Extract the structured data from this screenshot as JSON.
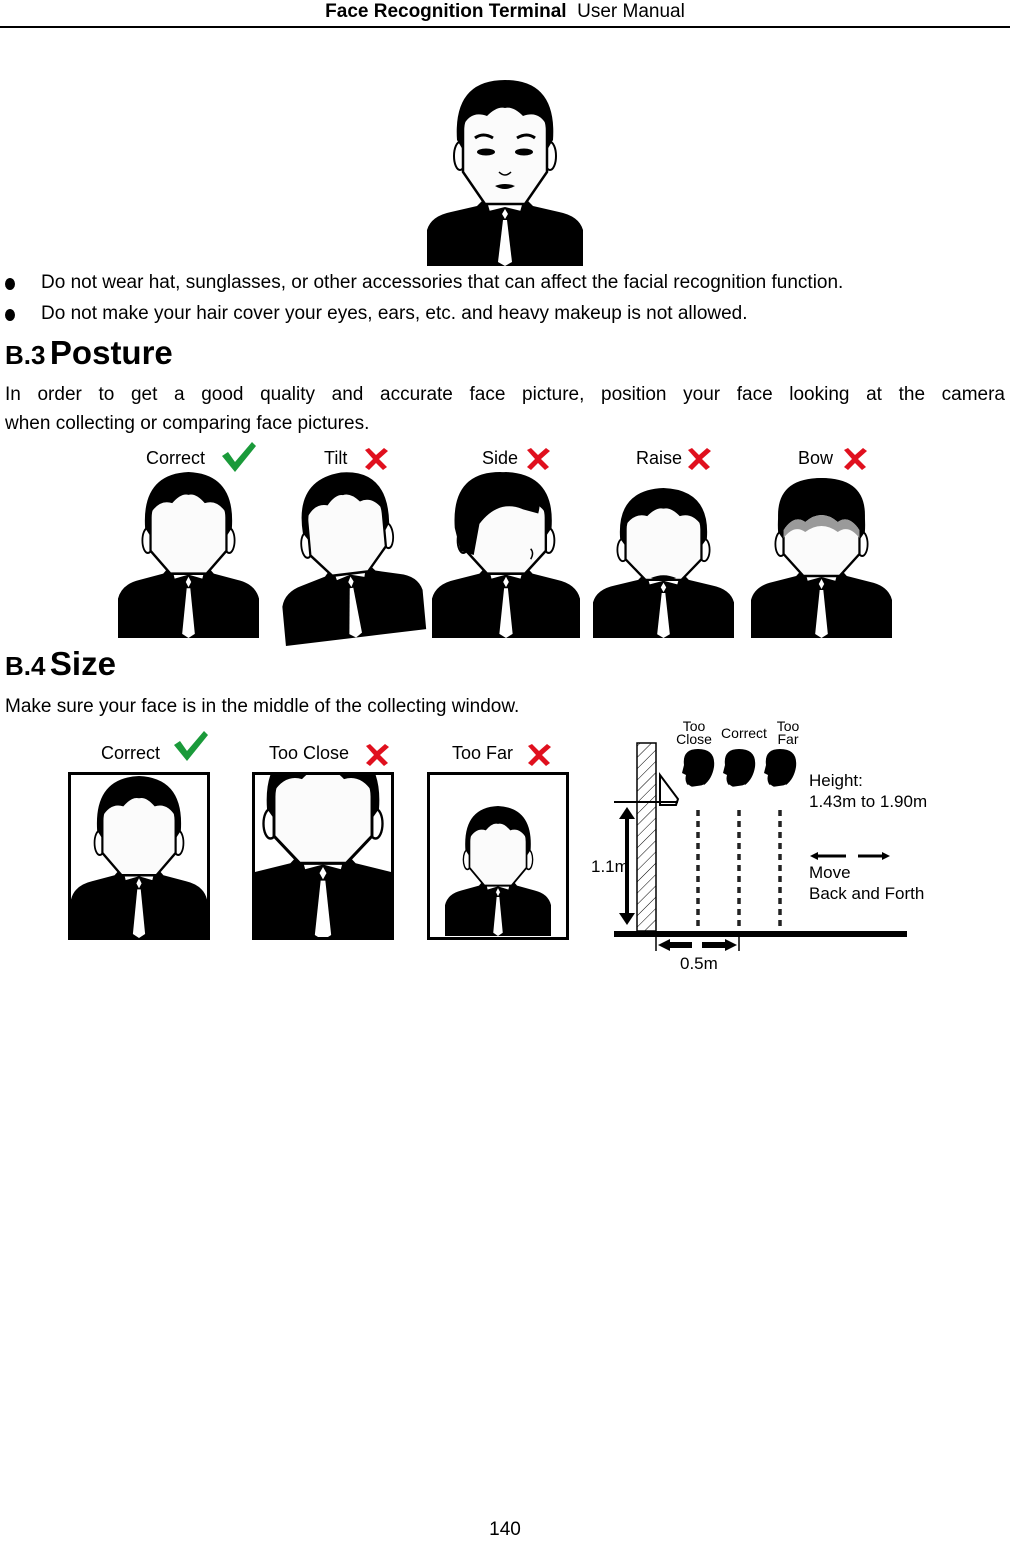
{
  "header": {
    "product": "Face Recognition Terminal",
    "doc": "User Manual"
  },
  "bullets": [
    "Do not wear hat, sunglasses, or other accessories that can affect the facial recognition function.",
    "Do not make your hair cover your eyes, ears, etc. and heavy makeup is not allowed."
  ],
  "posture": {
    "number": "B.3",
    "title": "Posture",
    "body_line1": "In order to get a good quality and accurate face picture, position your face looking at the camera",
    "body_line2": "when collecting or comparing face pictures.",
    "figures": [
      {
        "label": "Correct",
        "status": "check-icon"
      },
      {
        "label": "Tilt",
        "status": "cross-icon"
      },
      {
        "label": "Side",
        "status": "cross-icon"
      },
      {
        "label": "Raise",
        "status": "cross-icon"
      },
      {
        "label": "Bow",
        "status": "cross-icon"
      }
    ]
  },
  "size": {
    "number": "B.4",
    "title": "Size",
    "body": "Make sure your face is in the middle of the collecting window.",
    "figures": [
      {
        "label": "Correct",
        "status": "check-icon"
      },
      {
        "label": "Too Close",
        "status": "cross-icon"
      },
      {
        "label": "Too Far",
        "status": "cross-icon"
      }
    ],
    "diagram": {
      "too_close_1": "Too",
      "too_close_2": "Close",
      "correct": "Correct",
      "too_far_1": "Too",
      "too_far_2": "Far",
      "height_label": "Height:",
      "height_range": "1.43m to 1.90m",
      "move_1": "Move",
      "move_2": "Back and Forth",
      "mount_height": "1.1m",
      "distance": "0.5m"
    }
  },
  "colors": {
    "check": "#1a9a3a",
    "cross": "#e0101e",
    "bow_shadow": "#9a9a9a"
  },
  "page_number": "140"
}
